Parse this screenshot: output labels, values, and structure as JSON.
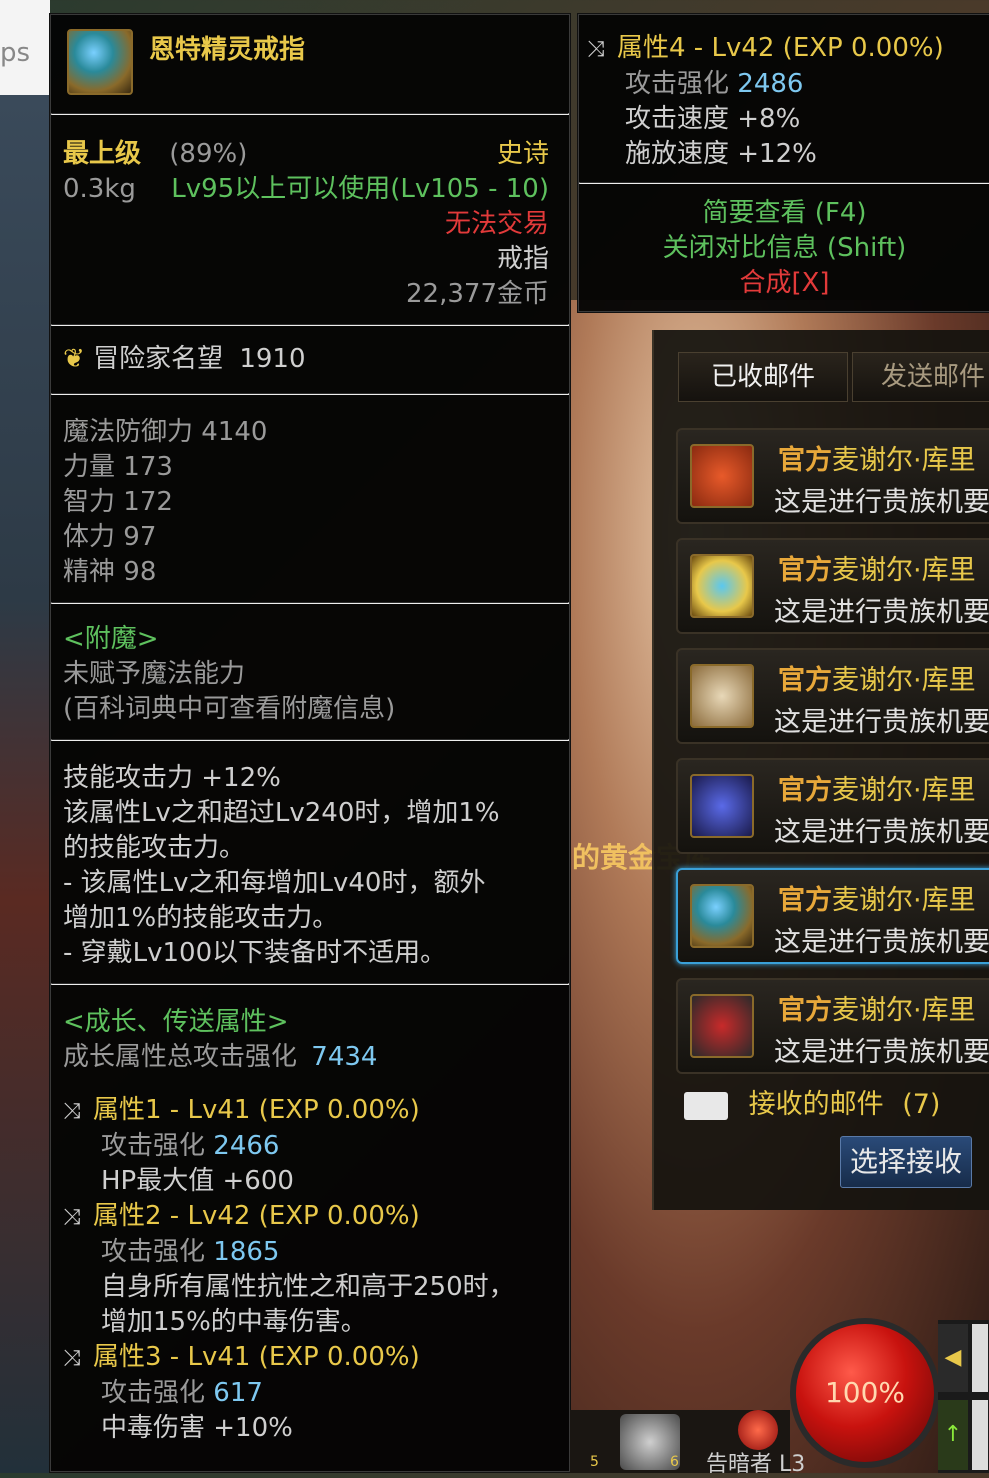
{
  "background": {
    "url_fragment": "ps",
    "game_text_mid": "的黄金宝库",
    "bottom_label": "告暗者 L3",
    "slot_5": "5",
    "slot_6": "6"
  },
  "item": {
    "name": "恩特精灵戒指",
    "grade": "最上级",
    "grade_pct": "(89%)",
    "rarity": "史诗",
    "weight": "0.3kg",
    "level_req": "Lv95以上可以使用(Lv105 - 10)",
    "trade": "无法交易",
    "type": "戒指",
    "price": "22,377金币",
    "fame_label": "冒险家名望",
    "fame_value": "1910",
    "stats": [
      {
        "label": "魔法防御力",
        "value": "4140"
      },
      {
        "label": "力量",
        "value": "173"
      },
      {
        "label": "智力",
        "value": "172"
      },
      {
        "label": "体力",
        "value": "97"
      },
      {
        "label": "精神",
        "value": "98"
      }
    ],
    "enchant_title": "<附魔>",
    "enchant_line1": "未赋予魔法能力",
    "enchant_line2": "(百科词典中可查看附魔信息)",
    "skill_lines": [
      "技能攻击力 +12%",
      "该属性Lv之和超过Lv240时，增加1%",
      "的技能攻击力。",
      "- 该属性Lv之和每增加Lv40时，额外",
      "增加1%的技能攻击力。",
      "- 穿戴Lv100以下装备时不适用。"
    ],
    "growth_title": "<成长、传送属性>",
    "growth_total_label": "成长属性总攻击强化",
    "growth_total_value": "7434",
    "attrs": [
      {
        "title": "属性1 - Lv41 (EXP 0.00%)",
        "atk_label": "攻击强化",
        "atk_value": "2466",
        "extra": [
          "HP最大值 +600"
        ]
      },
      {
        "title": "属性2 - Lv42 (EXP 0.00%)",
        "atk_label": "攻击强化",
        "atk_value": "1865",
        "extra": [
          "自身所有属性抗性之和高于250时，",
          "增加15%的中毒伤害。"
        ]
      },
      {
        "title": "属性3 - Lv41 (EXP 0.00%)",
        "atk_label": "攻击强化",
        "atk_value": "617",
        "extra": [
          "中毒伤害 +10%"
        ]
      }
    ],
    "attr4": {
      "title": "属性4 - Lv42 (EXP 0.00%)",
      "atk_label": "攻击强化",
      "atk_value": "2486",
      "atk_speed": "攻击速度 +8%",
      "cast_speed": "施放速度 +12%"
    },
    "hint_brief": "简要查看 (F4)",
    "hint_compare": "关闭对比信息 (Shift)",
    "hint_synth": "合成[X]"
  },
  "mail": {
    "tab_received": "已收邮件",
    "tab_sent": "发送邮件",
    "items": [
      {
        "official": "官方",
        "sender": "麦谢尔·库里",
        "subject": "这是进行贵族机要"
      },
      {
        "official": "官方",
        "sender": "麦谢尔·库里",
        "subject": "这是进行贵族机要"
      },
      {
        "official": "官方",
        "sender": "麦谢尔·库里",
        "subject": "这是进行贵族机要"
      },
      {
        "official": "官方",
        "sender": "麦谢尔·库里",
        "subject": "这是进行贵族机要"
      },
      {
        "official": "官方",
        "sender": "麦谢尔·库里",
        "subject": "这是进行贵族机要"
      },
      {
        "official": "官方",
        "sender": "麦谢尔·库里",
        "subject": "这是进行贵族机要"
      }
    ],
    "received_label": "接收的邮件",
    "received_count": "(7)",
    "select_receive": "选择接收"
  },
  "hud": {
    "hp_percent": "100%"
  }
}
